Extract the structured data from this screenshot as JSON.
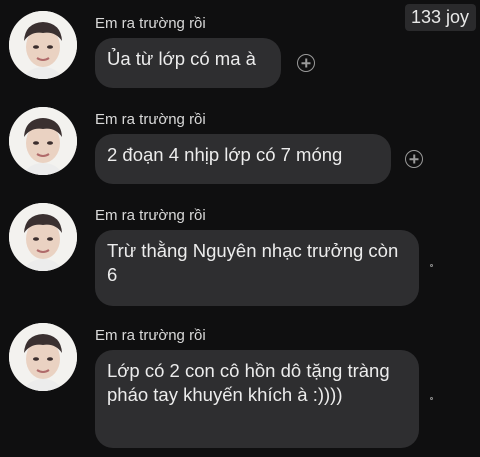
{
  "counter": "133 joy",
  "messages": [
    {
      "sender": "Em ra trường rồi",
      "text": "Ủa từ lớp có ma à",
      "reaction": "add-reaction-icon"
    },
    {
      "sender": "Em ra trường rồi",
      "text": "2 đoạn 4 nhịp lớp có 7 móng",
      "reaction": "add-reaction-icon"
    },
    {
      "sender": "Em ra trường rồi",
      "text": "Trừ thằng Nguyên nhạc trưởng còn 6",
      "reaction": "read-status-dot"
    },
    {
      "sender": "Em ra trường rồi",
      "text": "Lớp có 2 con cô hồn dô tặng tràng pháo tay khuyến khích à :))))",
      "reaction": "read-status-dot"
    }
  ]
}
